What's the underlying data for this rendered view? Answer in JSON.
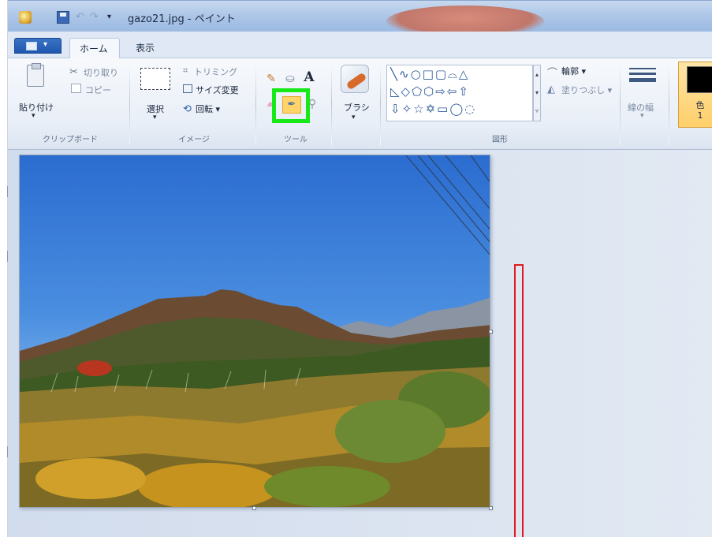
{
  "window": {
    "title": "gazo21.jpg - ペイント"
  },
  "tabs": {
    "home": "ホーム",
    "view": "表示"
  },
  "clipboard": {
    "paste": "貼り付け",
    "cut": "切り取り",
    "copy": "コピー",
    "group_label": "クリップボード"
  },
  "image": {
    "select": "選択",
    "crop": "トリミング",
    "resize": "サイズ変更",
    "rotate": "回転",
    "group_label": "イメージ"
  },
  "tools": {
    "group_label": "ツール",
    "text_glyph": "A"
  },
  "brush": {
    "label": "ブラシ"
  },
  "shapes": {
    "group_label": "図形",
    "outline": "輪郭",
    "fill": "塗りつぶし",
    "row1": "╲∿○□▢⌓△",
    "row2": "◺◇⬠⬡⇨⇦⇧",
    "row3": "⇩✧☆✡▭◯◌"
  },
  "size": {
    "label": "線の幅"
  },
  "color1": {
    "label_top": "色",
    "label_bottom": "1",
    "swatch_color": "#000000"
  },
  "highlight": {
    "color": "#17e817",
    "target": "color-picker-tool"
  }
}
